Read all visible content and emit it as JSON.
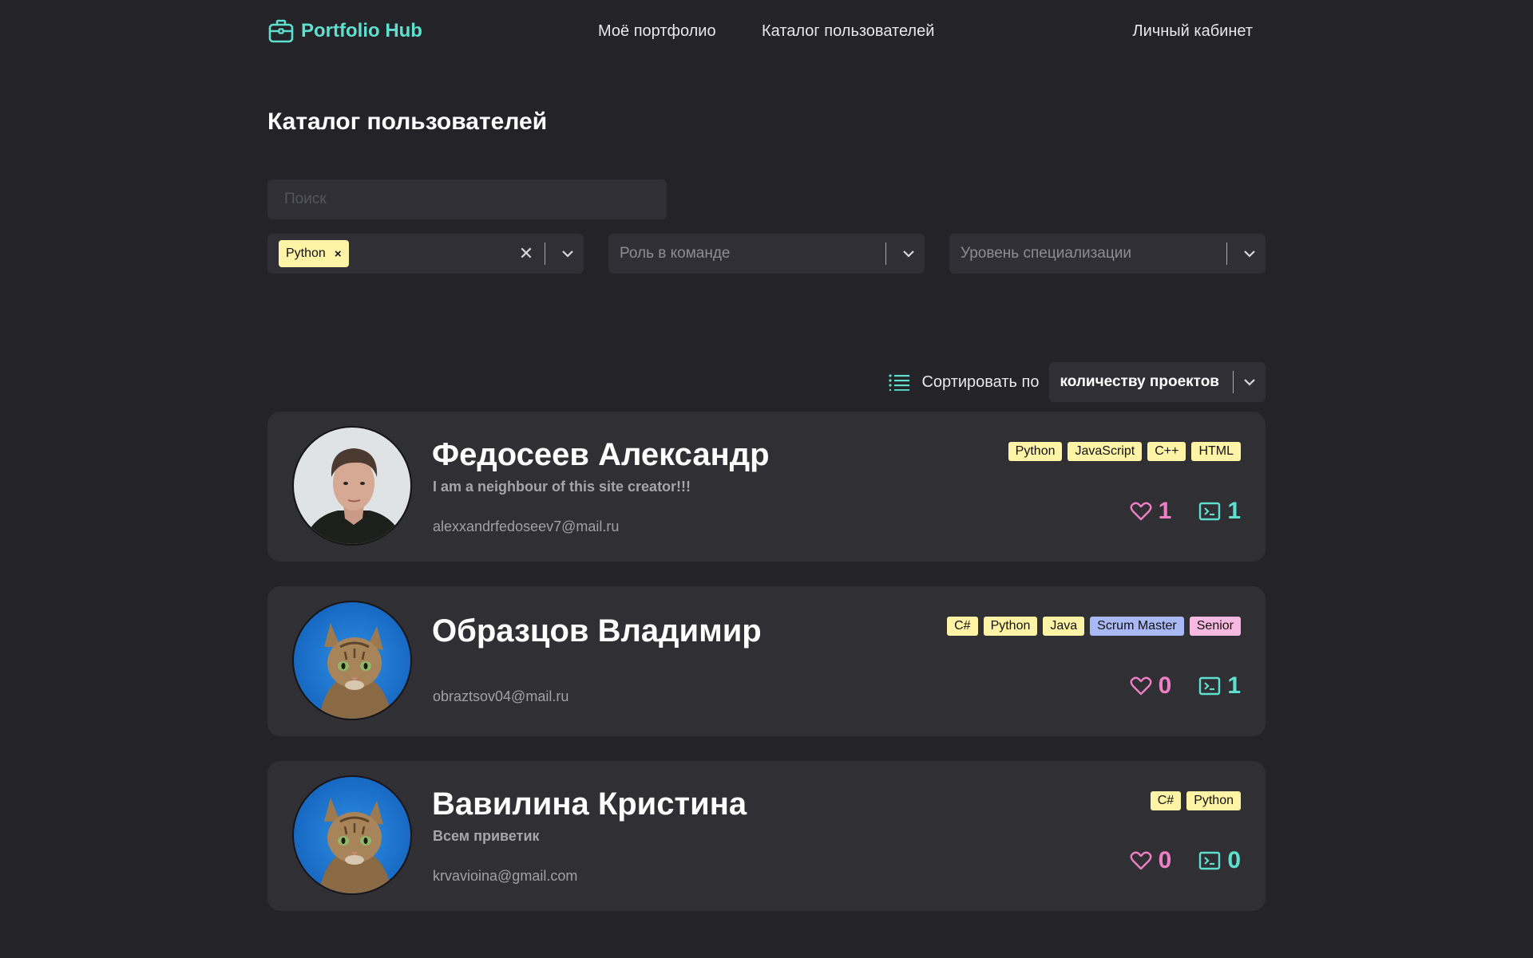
{
  "header": {
    "logo_text": "Portfolio Hub",
    "nav": {
      "portfolio": "Моё портфолио",
      "catalog": "Каталог пользователей",
      "account": "Личный кабинет"
    }
  },
  "page": {
    "title": "Каталог пользователей"
  },
  "search": {
    "placeholder": "Поиск",
    "value": ""
  },
  "filters": {
    "language": {
      "selected_chip": "Python",
      "chip_remove": "×",
      "clear": "✕"
    },
    "role": {
      "placeholder": "Роль в команде"
    },
    "level": {
      "placeholder": "Уровень специализации"
    }
  },
  "sort": {
    "label": "Сортировать по",
    "value": "количеству проектов"
  },
  "colors": {
    "background": "#232328",
    "surface": "#2f2f35",
    "accent": "#5fe0cf",
    "likes": "#ee7fc4",
    "tag_yellow": "#fff3a6",
    "tag_blue": "#a9b9f5",
    "tag_pink": "#f7b9e0"
  },
  "users": [
    {
      "name": "Федосеев Александр",
      "bio": "I am a neighbour of this site creator!!!",
      "email": "alexxandrfedoseev7@mail.ru",
      "avatar": "person-photo",
      "tags": [
        {
          "label": "Python",
          "color": "yellow"
        },
        {
          "label": "JavaScript",
          "color": "yellow"
        },
        {
          "label": "C++",
          "color": "yellow"
        },
        {
          "label": "HTML",
          "color": "yellow"
        }
      ],
      "likes": "1",
      "projects": "1"
    },
    {
      "name": "Образцов Владимир",
      "bio": "",
      "email": "obraztsov04@mail.ru",
      "avatar": "cat-photo",
      "tags": [
        {
          "label": "C#",
          "color": "yellow"
        },
        {
          "label": "Python",
          "color": "yellow"
        },
        {
          "label": "Java",
          "color": "yellow"
        },
        {
          "label": "Scrum Master",
          "color": "blue"
        },
        {
          "label": "Senior",
          "color": "pink"
        }
      ],
      "likes": "0",
      "projects": "1"
    },
    {
      "name": "Вавилина Кристина",
      "bio": "Всем приветик",
      "email": "krvavioina@gmail.com",
      "avatar": "cat-photo",
      "tags": [
        {
          "label": "C#",
          "color": "yellow"
        },
        {
          "label": "Python",
          "color": "yellow"
        }
      ],
      "likes": "0",
      "projects": "0"
    }
  ]
}
